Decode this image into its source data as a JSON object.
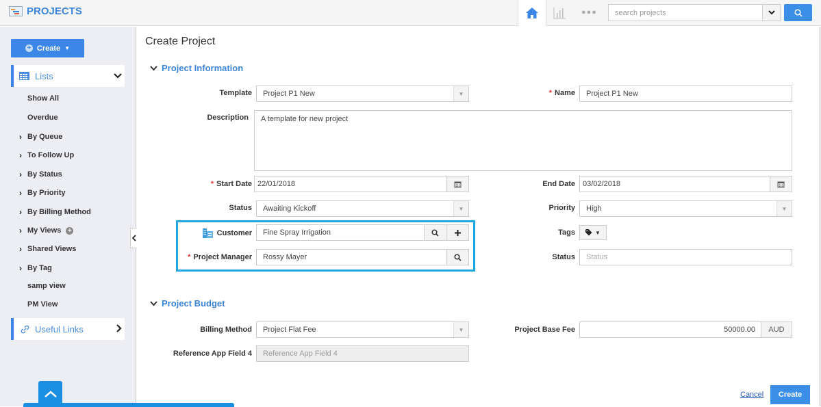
{
  "app": {
    "title": "PROJECTS"
  },
  "topnav": {
    "icons": [
      "home-icon",
      "chart-icon",
      "more-icon"
    ],
    "search": {
      "placeholder": "search projects",
      "value": ""
    }
  },
  "sidebar": {
    "create_label": "Create",
    "lists_label": "Lists",
    "items": [
      {
        "label": "Show All",
        "expandable": false
      },
      {
        "label": "Overdue",
        "expandable": false
      },
      {
        "label": "By Queue",
        "expandable": true
      },
      {
        "label": "To Follow Up",
        "expandable": true
      },
      {
        "label": "By Status",
        "expandable": true
      },
      {
        "label": "By Priority",
        "expandable": true
      },
      {
        "label": "By Billing Method",
        "expandable": true
      },
      {
        "label": "My Views",
        "expandable": true
      },
      {
        "label": "Shared Views",
        "expandable": true
      },
      {
        "label": "By Tag",
        "expandable": true
      },
      {
        "label": "samp view",
        "expandable": false
      },
      {
        "label": "PM View",
        "expandable": false
      }
    ],
    "useful_links_label": "Useful Links"
  },
  "form": {
    "title": "Create Project",
    "sections": {
      "info": "Project Information",
      "budget": "Project Budget"
    },
    "fields": {
      "template": {
        "label": "Template",
        "value": "Project P1 New"
      },
      "name": {
        "label": "Name",
        "value": "Project P1 New",
        "required": true
      },
      "description": {
        "label": "Description",
        "value": "A template for new project"
      },
      "start_date": {
        "label": "Start Date",
        "value": "22/01/2018",
        "required": true
      },
      "end_date": {
        "label": "End Date",
        "value": "03/02/2018"
      },
      "status": {
        "label": "Status",
        "value": "Awaiting Kickoff"
      },
      "priority": {
        "label": "Priority",
        "value": "High"
      },
      "customer": {
        "label": "Customer",
        "value": "Fine Spray Irrigation"
      },
      "tags": {
        "label": "Tags"
      },
      "project_manager": {
        "label": "Project Manager",
        "value": "Rossy Mayer",
        "required": true
      },
      "status2": {
        "label": "Status",
        "placeholder": "Status",
        "value": ""
      },
      "billing_method": {
        "label": "Billing Method",
        "value": "Project Flat Fee"
      },
      "base_fee": {
        "label": "Project Base Fee",
        "value": "50000.00",
        "currency": "AUD"
      },
      "ref_field_4": {
        "label": "Reference App Field 4",
        "placeholder": "Reference App Field 4",
        "value": ""
      }
    },
    "actions": {
      "cancel": "Cancel",
      "create": "Create"
    }
  },
  "colors": {
    "accent": "#3b86e6",
    "highlight": "#1fa7e1",
    "required": "#dd3333"
  }
}
